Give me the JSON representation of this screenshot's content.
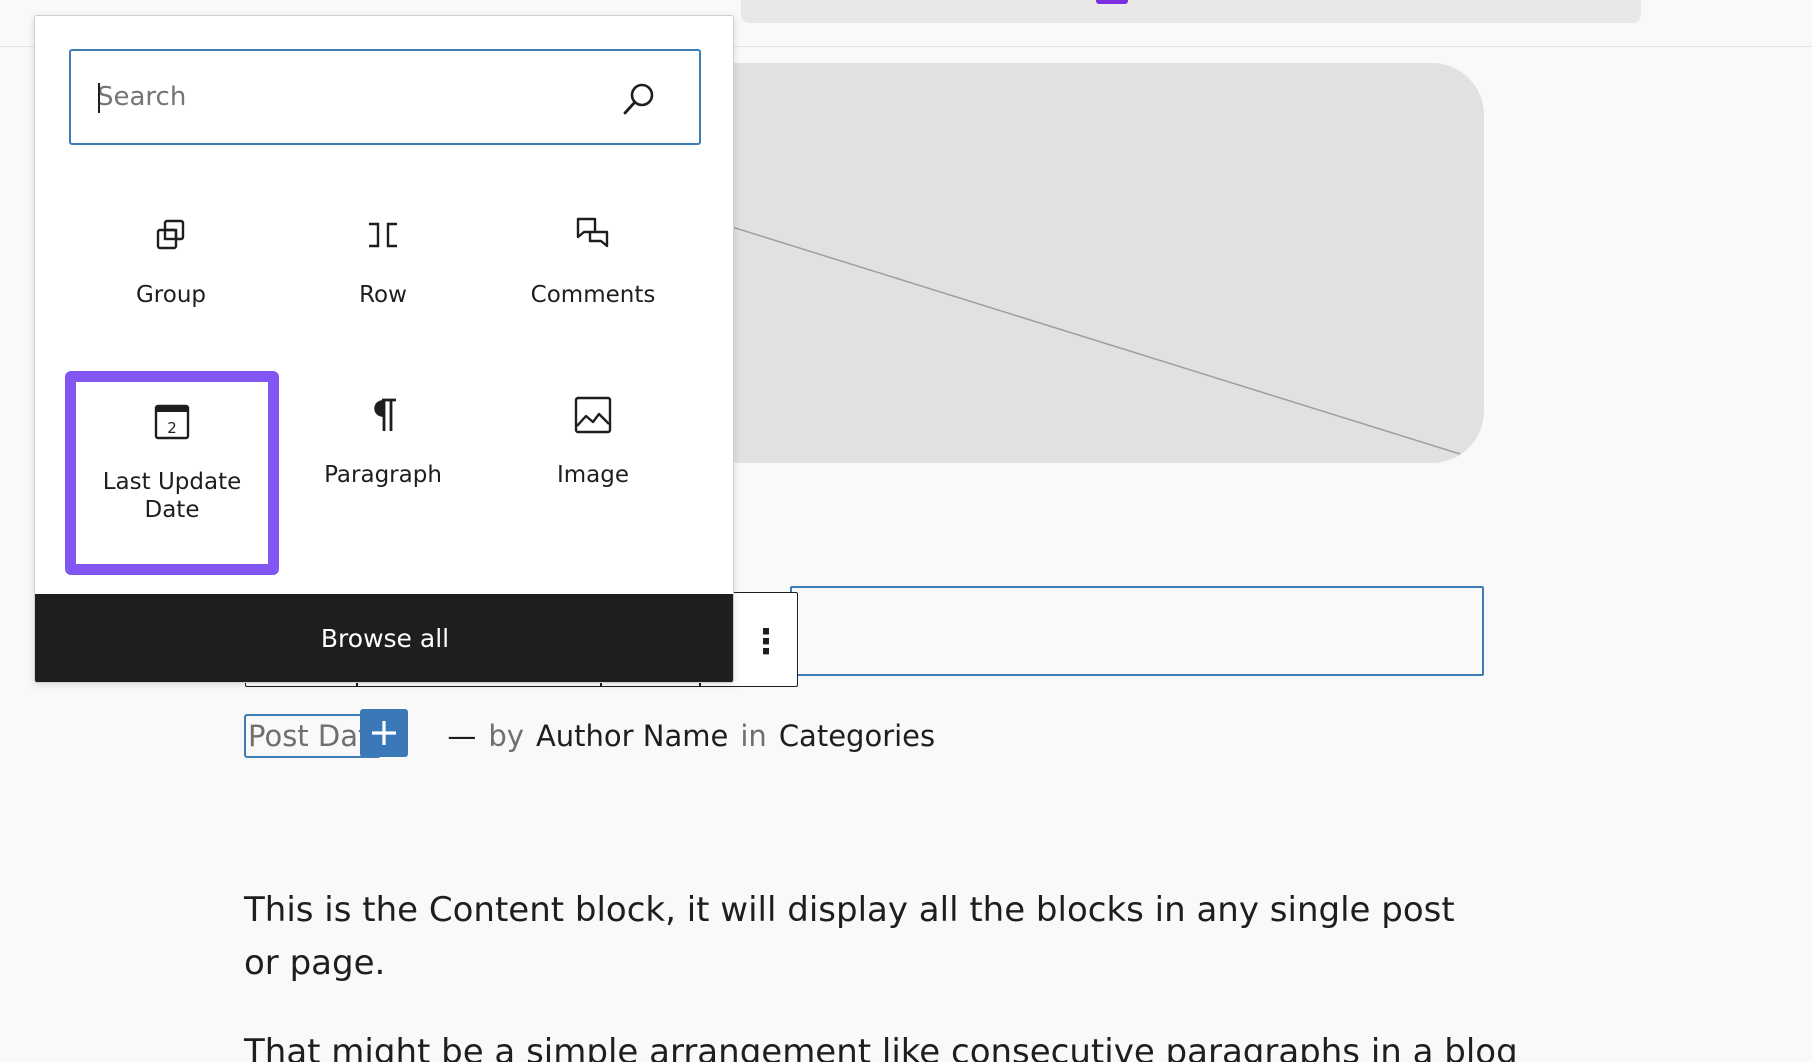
{
  "inserter": {
    "search_placeholder": "Search",
    "blocks": [
      {
        "label": "Group",
        "icon": "group-icon"
      },
      {
        "label": "Row",
        "icon": "row-icon"
      },
      {
        "label": "Comments",
        "icon": "comments-icon"
      },
      {
        "label": "Last Update Date",
        "icon": "calendar-icon",
        "selected": true
      },
      {
        "label": "Paragraph",
        "icon": "paragraph-icon"
      },
      {
        "label": "Image",
        "icon": "image-icon"
      }
    ],
    "browse_all_label": "Browse all"
  },
  "post_meta": {
    "date": "Post Dat",
    "separator": "—",
    "by": "by",
    "author": "Author Name",
    "in": "in",
    "categories": "Categories"
  },
  "content": {
    "paragraph_1": "This is the Content block, it will display all the blocks in any single post or page.",
    "paragraph_2": "That might be a simple arrangement like consecutive paragraphs in a blog"
  },
  "colors": {
    "accent": "#3e7cb8",
    "highlight": "#8156f2",
    "dark": "#1e1e1e"
  }
}
